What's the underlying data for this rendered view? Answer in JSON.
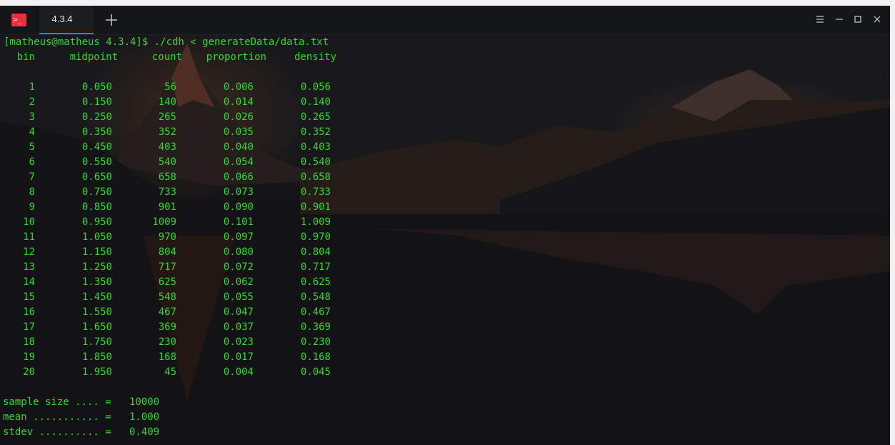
{
  "window": {
    "tab_label": "4.3.4",
    "app_icon": "terminal-icon",
    "new_tab_icon": "plus-icon",
    "menu_icon": "hamburger-icon",
    "minimize_icon": "minimize-icon",
    "maximize_icon": "maximize-icon",
    "close_icon": "close-icon",
    "accent_color": "#2f82d6",
    "icon_color": "#e4313c"
  },
  "terminal": {
    "prompt": "[matheus@matheus 4.3.4]$ ./cdh < generateData/data.txt",
    "text_color": "#33d733",
    "headers": {
      "bin": "bin",
      "midpoint": "midpoint",
      "count": "count",
      "proportion": "proportion",
      "density": "density"
    },
    "rows": [
      {
        "bin": "1",
        "midpoint": "0.050",
        "count": "56",
        "proportion": "0.006",
        "density": "0.056"
      },
      {
        "bin": "2",
        "midpoint": "0.150",
        "count": "140",
        "proportion": "0.014",
        "density": "0.140"
      },
      {
        "bin": "3",
        "midpoint": "0.250",
        "count": "265",
        "proportion": "0.026",
        "density": "0.265"
      },
      {
        "bin": "4",
        "midpoint": "0.350",
        "count": "352",
        "proportion": "0.035",
        "density": "0.352"
      },
      {
        "bin": "5",
        "midpoint": "0.450",
        "count": "403",
        "proportion": "0.040",
        "density": "0.403"
      },
      {
        "bin": "6",
        "midpoint": "0.550",
        "count": "540",
        "proportion": "0.054",
        "density": "0.540"
      },
      {
        "bin": "7",
        "midpoint": "0.650",
        "count": "658",
        "proportion": "0.066",
        "density": "0.658"
      },
      {
        "bin": "8",
        "midpoint": "0.750",
        "count": "733",
        "proportion": "0.073",
        "density": "0.733"
      },
      {
        "bin": "9",
        "midpoint": "0.850",
        "count": "901",
        "proportion": "0.090",
        "density": "0.901"
      },
      {
        "bin": "10",
        "midpoint": "0.950",
        "count": "1009",
        "proportion": "0.101",
        "density": "1.009"
      },
      {
        "bin": "11",
        "midpoint": "1.050",
        "count": "970",
        "proportion": "0.097",
        "density": "0.970"
      },
      {
        "bin": "12",
        "midpoint": "1.150",
        "count": "804",
        "proportion": "0.080",
        "density": "0.804"
      },
      {
        "bin": "13",
        "midpoint": "1.250",
        "count": "717",
        "proportion": "0.072",
        "density": "0.717"
      },
      {
        "bin": "14",
        "midpoint": "1.350",
        "count": "625",
        "proportion": "0.062",
        "density": "0.625"
      },
      {
        "bin": "15",
        "midpoint": "1.450",
        "count": "548",
        "proportion": "0.055",
        "density": "0.548"
      },
      {
        "bin": "16",
        "midpoint": "1.550",
        "count": "467",
        "proportion": "0.047",
        "density": "0.467"
      },
      {
        "bin": "17",
        "midpoint": "1.650",
        "count": "369",
        "proportion": "0.037",
        "density": "0.369"
      },
      {
        "bin": "18",
        "midpoint": "1.750",
        "count": "230",
        "proportion": "0.023",
        "density": "0.230"
      },
      {
        "bin": "19",
        "midpoint": "1.850",
        "count": "168",
        "proportion": "0.017",
        "density": "0.168"
      },
      {
        "bin": "20",
        "midpoint": "1.950",
        "count": "45",
        "proportion": "0.004",
        "density": "0.045"
      }
    ],
    "stats": [
      "sample size .... =   10000",
      "mean ........... =   1.000",
      "stdev .......... =   0.409"
    ]
  }
}
